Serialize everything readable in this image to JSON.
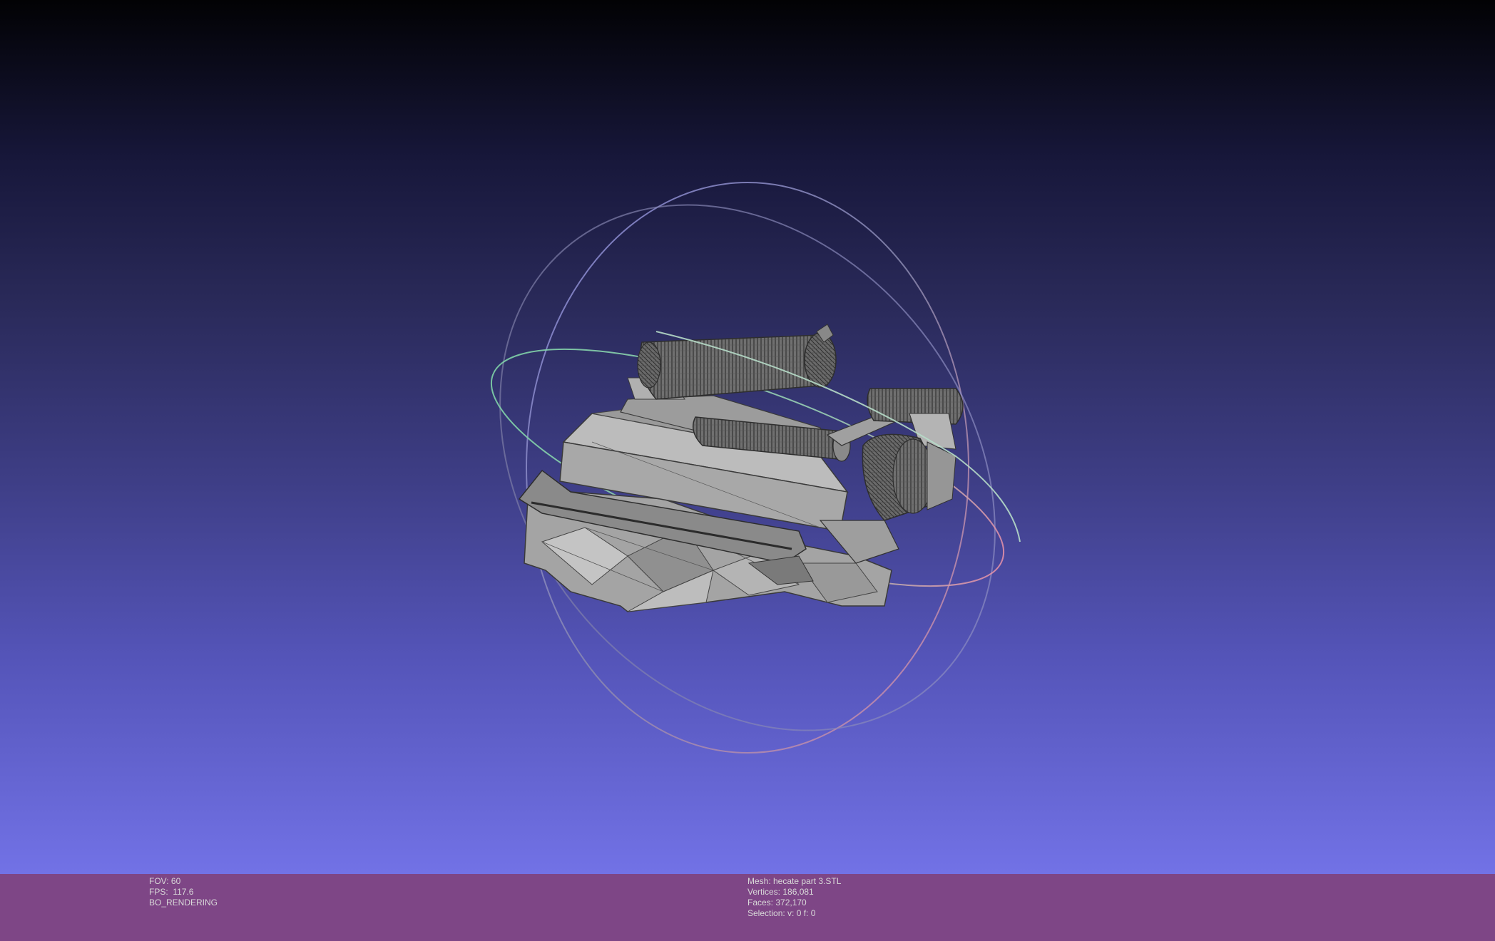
{
  "app": {
    "name": "MeshLab viewer"
  },
  "viewport": {
    "background_top": "#020204",
    "background_bottom": "#7272e6",
    "mesh_color": "#a9a9a9",
    "mesh_wire_color": "#3a3a3a",
    "trackball": {
      "ring_colors": [
        "#7fd3a8",
        "#8e8ee0",
        "#e08ea8"
      ]
    }
  },
  "info_left": {
    "fov": "FOV: 60",
    "fps": "FPS:  117.6",
    "render_mode": "BO_RENDERING"
  },
  "info_right": {
    "mesh": "Mesh: hecate part 3.STL",
    "vertices": "Vertices: 186,081",
    "faces": "Faces: 372,170",
    "selection": "Selection: v: 0 f: 0"
  },
  "info_bar": {
    "color": "#7e4686"
  }
}
